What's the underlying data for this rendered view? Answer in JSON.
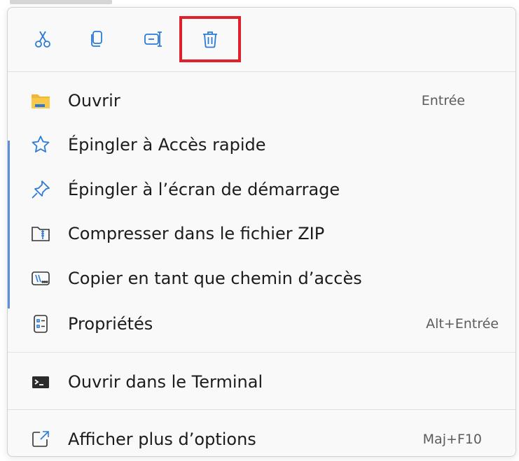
{
  "toolbar": {
    "buttons": [
      {
        "name": "cut",
        "icon": "scissors-icon"
      },
      {
        "name": "copy",
        "icon": "copy-icon"
      },
      {
        "name": "rename",
        "icon": "rename-icon"
      },
      {
        "name": "delete",
        "icon": "trash-icon",
        "highlighted": true
      }
    ]
  },
  "items": [
    {
      "label": "Ouvrir",
      "shortcut": "Entrée",
      "icon": "folder-icon"
    },
    {
      "label": "Épingler à Accès rapide",
      "shortcut": "",
      "icon": "star-icon"
    },
    {
      "label": "Épingler à l’écran de démarrage",
      "shortcut": "",
      "icon": "pin-icon"
    },
    {
      "label": "Compresser dans le fichier ZIP",
      "shortcut": "",
      "icon": "zip-icon"
    },
    {
      "label": "Copier en tant que chemin d’accès",
      "shortcut": "",
      "icon": "path-icon"
    },
    {
      "label": "Propriétés",
      "shortcut": "Alt+Entrée",
      "icon": "properties-icon"
    }
  ],
  "terminal": {
    "label": "Ouvrir dans le Terminal",
    "icon": "terminal-icon"
  },
  "more": {
    "label": "Afficher plus d’options",
    "shortcut": "Maj+F10",
    "icon": "more-options-icon"
  },
  "colors": {
    "accent": "#2b7bd6",
    "highlight_border": "#e0202a",
    "folder": "#f2b632"
  }
}
